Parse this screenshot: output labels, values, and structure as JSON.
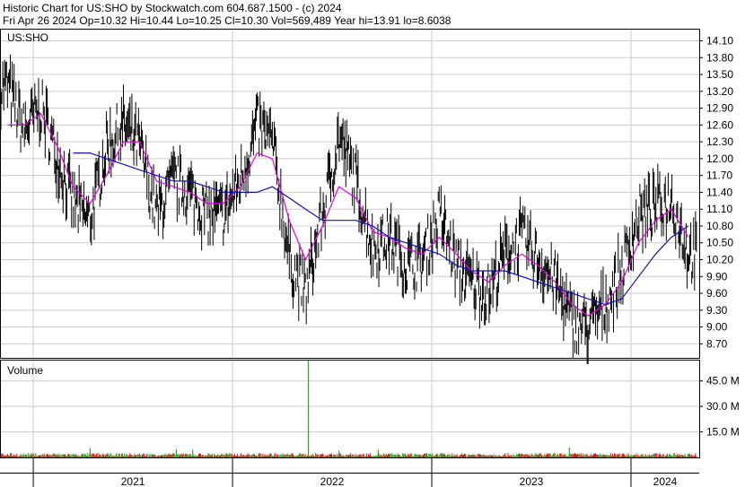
{
  "header": {
    "line1": "Historic Chart for US:SHO by Stockwatch.com 604.687.1500 - (c) 2024",
    "line2": "Fri Apr 26 2024   Op=10.32   Hi=10.44   Lo=10.25   Cl=10.30   Vol=569,489   Year hi=13.91   lo=8.6038"
  },
  "colors": {
    "price": "#000000",
    "ma_short": "#e000e0",
    "ma_long": "#1010c0",
    "volume_up": "#22aa22",
    "volume_down": "#dd1111",
    "grid": "#cccccc",
    "frame": "#000000"
  },
  "chart_data": [
    {
      "type": "line",
      "title": "US:SHO",
      "ylim": [
        8.45,
        14.3
      ],
      "y_ticks": [
        "14.10",
        "13.80",
        "13.50",
        "13.20",
        "12.90",
        "12.60",
        "12.30",
        "12.00",
        "11.70",
        "11.40",
        "11.10",
        "10.80",
        "10.50",
        "10.20",
        "9.90",
        "9.60",
        "9.30",
        "9.00",
        "8.70"
      ],
      "grid": true,
      "series": [
        {
          "role": "price",
          "x": [
            "2020-11",
            "2020-12",
            "2021-01",
            "2021-02",
            "2021-03",
            "2021-04",
            "2021-05",
            "2021-06",
            "2021-07",
            "2021-08",
            "2021-09",
            "2021-10",
            "2021-11",
            "2021-12",
            "2022-01",
            "2022-02",
            "2022-03",
            "2022-04",
            "2022-05",
            "2022-06",
            "2022-07",
            "2022-08",
            "2022-09",
            "2022-10",
            "2022-11",
            "2022-12",
            "2023-01",
            "2023-02",
            "2023-03",
            "2023-04",
            "2023-05",
            "2023-06",
            "2023-07",
            "2023-08",
            "2023-09",
            "2023-10",
            "2023-11",
            "2023-12",
            "2024-01",
            "2024-02",
            "2024-03",
            "2024-04"
          ],
          "values": [
            13.3,
            12.5,
            12.9,
            12.0,
            11.2,
            10.9,
            12.2,
            12.6,
            12.2,
            11.0,
            11.6,
            11.4,
            11.0,
            11.0,
            11.6,
            12.6,
            12.3,
            10.2,
            9.6,
            11.0,
            12.4,
            11.6,
            10.4,
            10.6,
            10.1,
            10.2,
            11.0,
            10.1,
            9.8,
            9.6,
            10.3,
            10.6,
            10.2,
            9.8,
            9.1,
            9.0,
            9.4,
            10.0,
            11.0,
            11.1,
            11.3,
            10.3
          ]
        },
        {
          "role": "ma_short",
          "x": [
            "2020-11",
            "2020-12",
            "2021-01",
            "2021-02",
            "2021-03",
            "2021-04",
            "2021-05",
            "2021-06",
            "2021-07",
            "2021-08",
            "2021-09",
            "2021-10",
            "2021-11",
            "2021-12",
            "2022-01",
            "2022-02",
            "2022-03",
            "2022-04",
            "2022-05",
            "2022-06",
            "2022-07",
            "2022-08",
            "2022-09",
            "2022-10",
            "2022-11",
            "2022-12",
            "2023-01",
            "2023-02",
            "2023-03",
            "2023-04",
            "2023-05",
            "2023-06",
            "2023-07",
            "2023-08",
            "2023-09",
            "2023-10",
            "2023-11",
            "2023-12",
            "2024-01",
            "2024-02",
            "2024-03",
            "2024-04"
          ],
          "values": [
            12.6,
            12.6,
            12.8,
            12.2,
            11.5,
            11.2,
            11.7,
            12.3,
            12.3,
            11.6,
            11.5,
            11.4,
            11.2,
            11.2,
            11.5,
            12.1,
            12.0,
            10.9,
            10.2,
            10.8,
            11.5,
            11.3,
            10.7,
            10.6,
            10.4,
            10.3,
            10.6,
            10.3,
            10.0,
            9.8,
            10.1,
            10.3,
            10.1,
            9.8,
            9.4,
            9.2,
            9.4,
            9.8,
            10.5,
            10.9,
            11.1,
            10.6
          ]
        },
        {
          "role": "ma_long",
          "x": [
            "2021-03",
            "2021-04",
            "2021-05",
            "2021-06",
            "2021-07",
            "2021-08",
            "2021-09",
            "2021-10",
            "2021-11",
            "2021-12",
            "2022-01",
            "2022-02",
            "2022-03",
            "2022-04",
            "2022-05",
            "2022-06",
            "2022-07",
            "2022-08",
            "2022-09",
            "2022-10",
            "2022-11",
            "2022-12",
            "2023-01",
            "2023-02",
            "2023-03",
            "2023-04",
            "2023-05",
            "2023-06",
            "2023-07",
            "2023-08",
            "2023-09",
            "2023-10",
            "2023-11",
            "2023-12",
            "2024-01",
            "2024-02",
            "2024-03",
            "2024-04"
          ],
          "values": [
            12.1,
            12.1,
            12.0,
            11.9,
            11.8,
            11.7,
            11.6,
            11.6,
            11.5,
            11.4,
            11.4,
            11.4,
            11.5,
            11.3,
            11.1,
            10.9,
            10.9,
            10.9,
            10.8,
            10.6,
            10.5,
            10.4,
            10.3,
            10.1,
            10.0,
            10.0,
            10.0,
            9.9,
            9.8,
            9.7,
            9.6,
            9.5,
            9.4,
            9.5,
            9.9,
            10.3,
            10.6,
            10.8
          ]
        }
      ]
    },
    {
      "type": "bar",
      "title": "Volume",
      "ylim": [
        0,
        57
      ],
      "y_ticks": [
        "45.0 M",
        "30.0 M",
        "15.0 M"
      ],
      "unit": "M",
      "baseline": 1.5,
      "spikes": [
        {
          "x": "2022-05-20",
          "value": 57
        },
        {
          "x": "2021-04-15",
          "value": 5.5
        },
        {
          "x": "2021-09-20",
          "value": 4.8
        },
        {
          "x": "2021-10-20",
          "value": 4.5
        },
        {
          "x": "2022-07-15",
          "value": 4.0
        },
        {
          "x": "2022-09-25",
          "value": 4.5
        },
        {
          "x": "2023-09-10",
          "value": 5.8
        }
      ]
    }
  ],
  "x_axis": {
    "labels": [
      "2021",
      "2022",
      "2023",
      "2024"
    ],
    "range": [
      "2020-11-01",
      "2024-05-05"
    ],
    "dividers": [
      "2021-01-01",
      "2022-01-01",
      "2023-01-01",
      "2024-01-01"
    ]
  }
}
